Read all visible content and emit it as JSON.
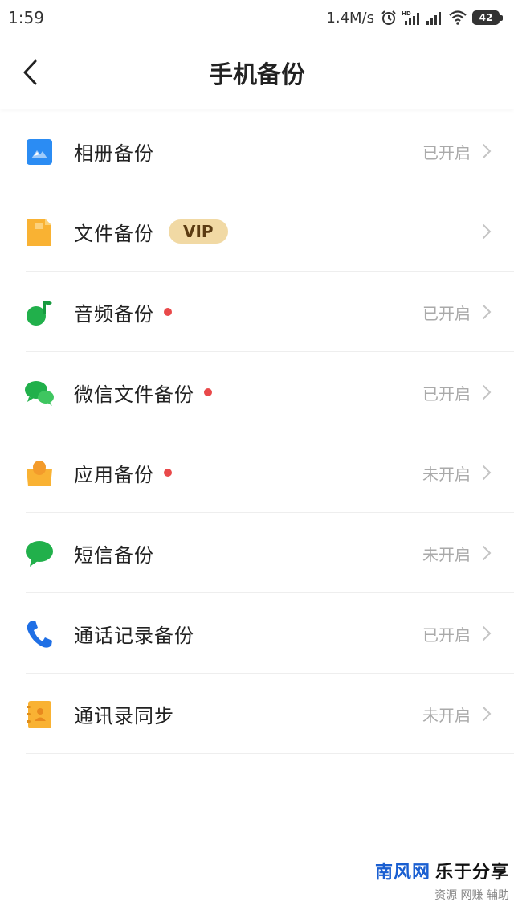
{
  "status_bar": {
    "time": "1:59",
    "speed": "1.4M/s",
    "battery": "42"
  },
  "nav": {
    "title": "手机备份"
  },
  "items": [
    {
      "label": "相册备份",
      "status": "已开启",
      "icon": "photo-album-icon",
      "red_dot": false,
      "vip": ""
    },
    {
      "label": "文件备份",
      "status": "",
      "icon": "file-icon",
      "red_dot": false,
      "vip": "VIP"
    },
    {
      "label": "音频备份",
      "status": "已开启",
      "icon": "music-note-icon",
      "red_dot": true,
      "vip": ""
    },
    {
      "label": "微信文件备份",
      "status": "已开启",
      "icon": "wechat-icon",
      "red_dot": true,
      "vip": ""
    },
    {
      "label": "应用备份",
      "status": "未开启",
      "icon": "app-bag-icon",
      "red_dot": true,
      "vip": ""
    },
    {
      "label": "短信备份",
      "status": "未开启",
      "icon": "sms-bubble-icon",
      "red_dot": false,
      "vip": ""
    },
    {
      "label": "通话记录备份",
      "status": "已开启",
      "icon": "phone-icon",
      "red_dot": false,
      "vip": ""
    },
    {
      "label": "通讯录同步",
      "status": "未开启",
      "icon": "contacts-book-icon",
      "red_dot": false,
      "vip": ""
    }
  ],
  "watermark": {
    "part1": "南风网",
    "part2": "乐于分享",
    "sub": "资源 网赚 辅助"
  },
  "colors": {
    "blue": "#2b8cf3",
    "orange": "#f9b233",
    "green": "#21b04b",
    "red_dot": "#e9494a",
    "vip_bg": "#f1d9a4"
  }
}
